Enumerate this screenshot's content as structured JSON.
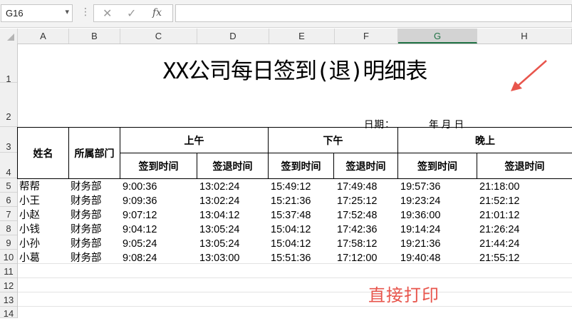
{
  "formula_bar": {
    "name_box": "G16",
    "formula": ""
  },
  "columns": [
    "A",
    "B",
    "C",
    "D",
    "E",
    "F",
    "G",
    "H"
  ],
  "rows": [
    "1",
    "2",
    "3",
    "4",
    "5",
    "6",
    "7",
    "8",
    "9",
    "10",
    "11",
    "12",
    "13",
    "14"
  ],
  "sheet": {
    "title": "XX公司每日签到(退)明细表",
    "date_label": "日期：",
    "date_parts": "年   月    日",
    "headers": {
      "name": "姓名",
      "dept": "所属部门",
      "morning": "上午",
      "afternoon": "下午",
      "evening": "晚上",
      "sign_in": "签到时间",
      "sign_out": "签退时间"
    },
    "records": [
      {
        "name": "帮帮",
        "dept": "财务部",
        "am_in": "9:00:36",
        "am_out": "13:02:24",
        "pm_in": "15:49:12",
        "pm_out": "17:49:48",
        "ev_in": "19:57:36",
        "ev_out": "21:18:00"
      },
      {
        "name": "小王",
        "dept": "财务部",
        "am_in": "9:09:36",
        "am_out": "13:02:24",
        "pm_in": "15:21:36",
        "pm_out": "17:25:12",
        "ev_in": "19:23:24",
        "ev_out": "21:52:12"
      },
      {
        "name": "小赵",
        "dept": "财务部",
        "am_in": "9:07:12",
        "am_out": "13:04:12",
        "pm_in": "15:37:48",
        "pm_out": "17:52:48",
        "ev_in": "19:36:00",
        "ev_out": "21:01:12"
      },
      {
        "name": "小钱",
        "dept": "财务部",
        "am_in": "9:04:12",
        "am_out": "13:05:24",
        "pm_in": "15:04:12",
        "pm_out": "17:42:36",
        "ev_in": "19:14:24",
        "ev_out": "21:26:24"
      },
      {
        "name": "小孙",
        "dept": "财务部",
        "am_in": "9:05:24",
        "am_out": "13:05:24",
        "pm_in": "15:04:12",
        "pm_out": "17:58:12",
        "ev_in": "19:21:36",
        "ev_out": "21:44:24"
      },
      {
        "name": "小葛",
        "dept": "财务部",
        "am_in": "9:08:24",
        "am_out": "13:03:00",
        "pm_in": "15:51:36",
        "pm_out": "17:12:00",
        "ev_in": "19:40:48",
        "ev_out": "21:55:12"
      }
    ],
    "annotation": "直接打印"
  },
  "colors": {
    "accent": "#217346",
    "annotation": "#e8554c"
  }
}
